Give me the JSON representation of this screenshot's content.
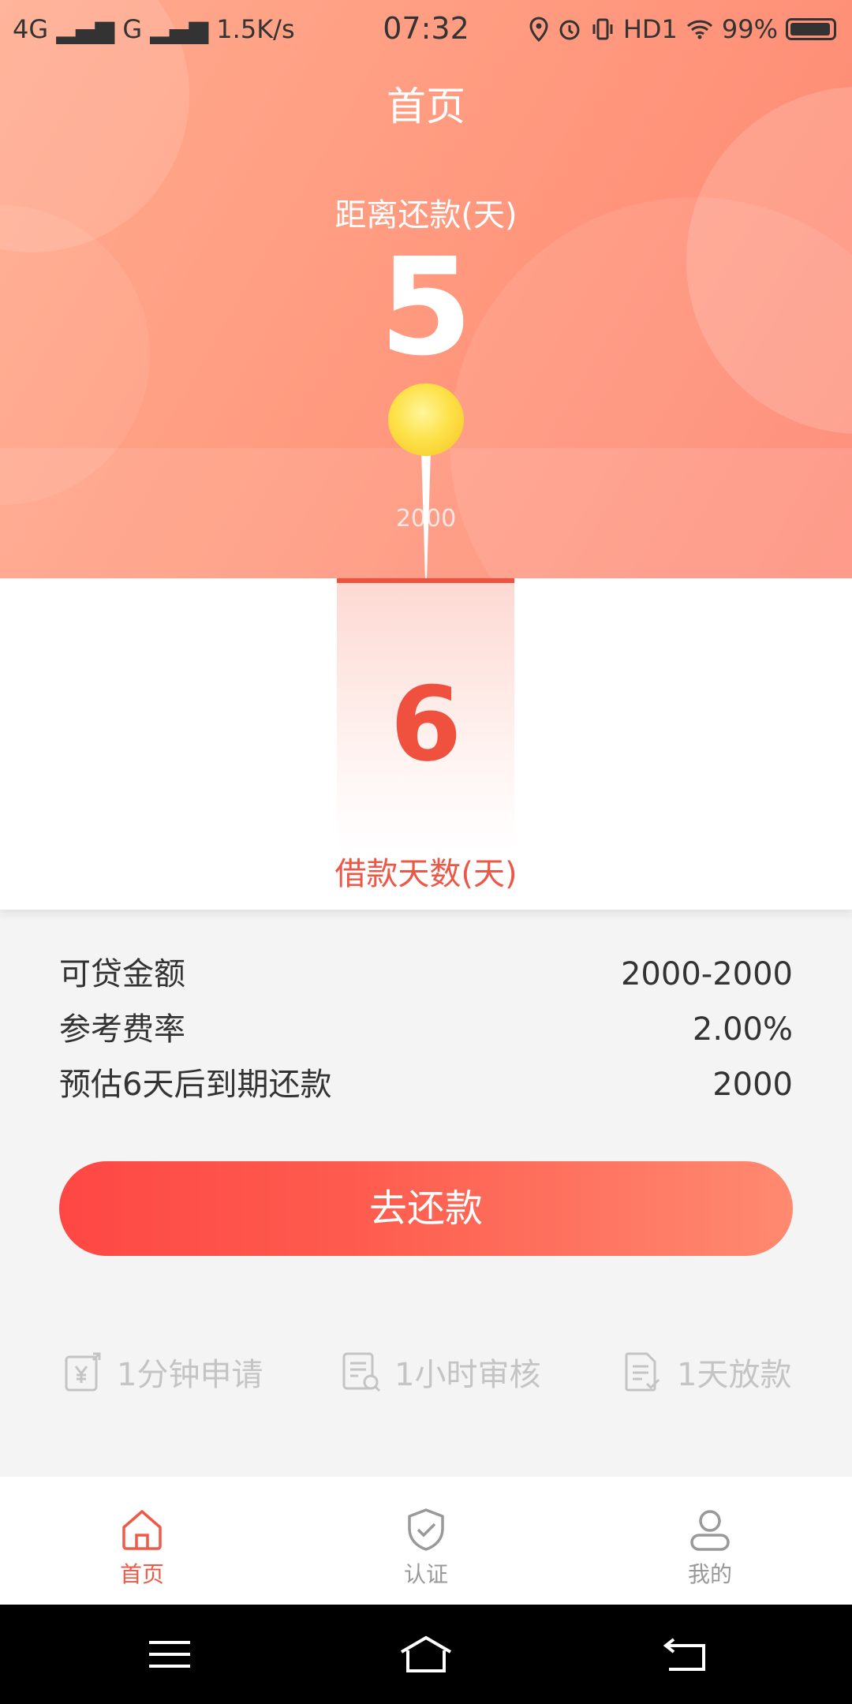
{
  "status_bar": {
    "network_left": "4G",
    "network_mid": "G",
    "speed": "1.5K/s",
    "time": "07:32",
    "hd": "HD1",
    "battery": "99%"
  },
  "header": {
    "title": "首页"
  },
  "countdown": {
    "label": "距离还款(天)",
    "value": "5"
  },
  "loan_amount_tick": "2000",
  "day_picker": {
    "selected_value": "6",
    "label": "借款天数(天)"
  },
  "info": [
    {
      "label": "可贷金额",
      "value": "2000-2000"
    },
    {
      "label": "参考费率",
      "value": "2.00%"
    },
    {
      "label": "预估6天后到期还款",
      "value": "2000"
    }
  ],
  "cta": {
    "label": "去还款"
  },
  "features": [
    {
      "icon": "yuan-apply-icon",
      "label": "1分钟申请"
    },
    {
      "icon": "review-doc-icon",
      "label": "1小时审核"
    },
    {
      "icon": "payout-doc-icon",
      "label": "1天放款"
    }
  ],
  "tabs": [
    {
      "icon": "home-icon",
      "label": "首页",
      "active": true
    },
    {
      "icon": "shield-check-icon",
      "label": "认证",
      "active": false
    },
    {
      "icon": "user-icon",
      "label": "我的",
      "active": false
    }
  ],
  "colors": {
    "accent": "#ef5a48",
    "hero_start": "#ffab8e",
    "hero_end": "#fe8570",
    "cta_start": "#fe4744",
    "cta_end": "#ff8a70"
  }
}
